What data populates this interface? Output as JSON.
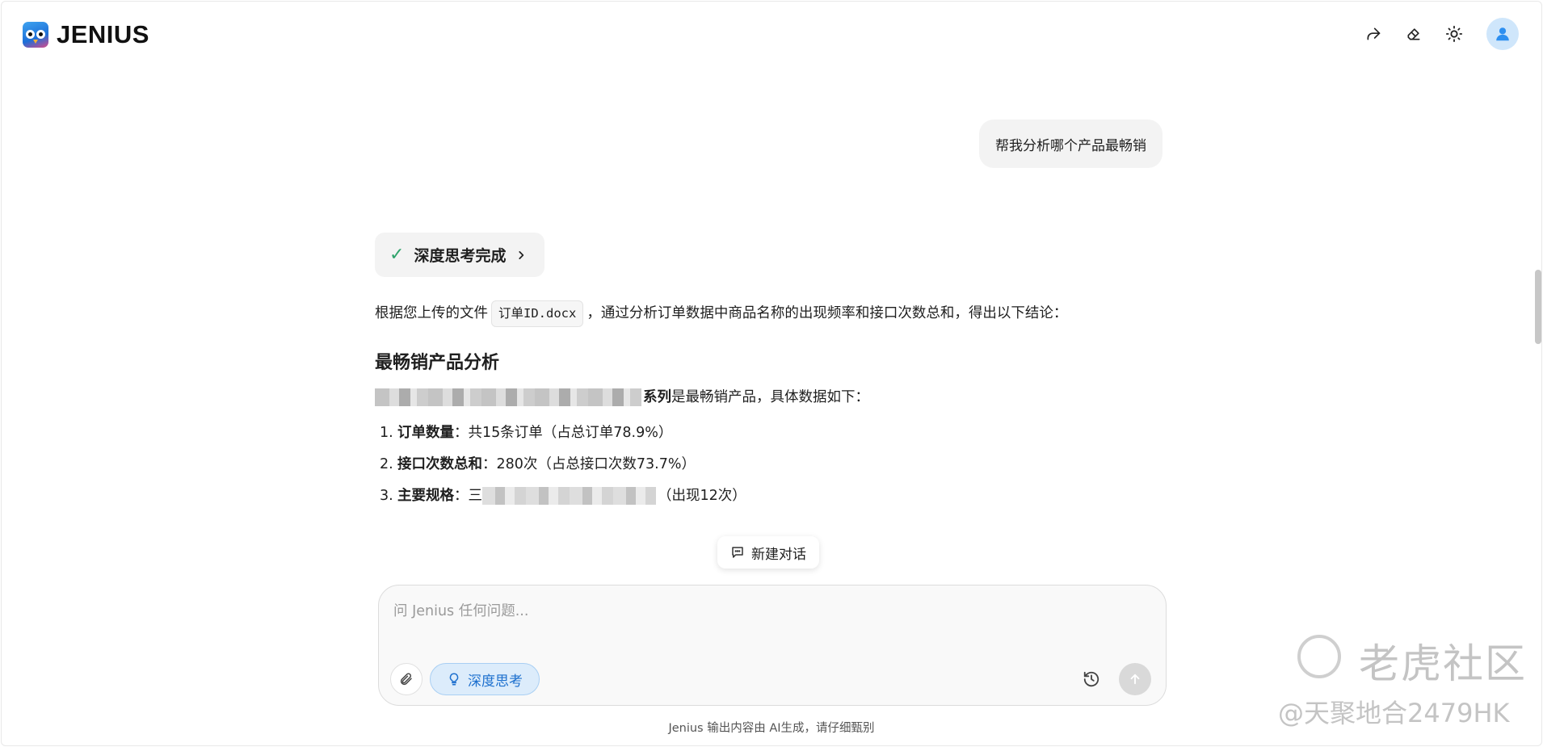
{
  "app": {
    "logo_text": "JENIUS"
  },
  "header": {
    "icons": [
      "share-icon",
      "eraser-icon",
      "sun-icon",
      "user-avatar-icon"
    ]
  },
  "chat": {
    "user_message": "帮我分析哪个产品最畅销",
    "thinking_status": "深度思考完成",
    "answer": {
      "intro_before": "根据您上传的文件",
      "file_name": "订单ID.docx",
      "intro_after": "，通过分析订单数据中商品名称的出现频率和接口次数总和，得出以下结论：",
      "heading": "最畅销产品分析",
      "product_suffix": "系列",
      "product_statement": " 是最畅销产品，具体数据如下：",
      "items": [
        {
          "num": "1.",
          "label": "订单数量",
          "value": "：共15条订单（占总订单78.9%）"
        },
        {
          "num": "2.",
          "label": "接口次数总和",
          "value": "：280次（占总接口次数73.7%）"
        },
        {
          "num": "3.",
          "label": "主要规格",
          "value_prefix": "：三",
          "value": "（出现12次）"
        }
      ]
    }
  },
  "new_chat_label": "新建对话",
  "composer": {
    "placeholder": "问 Jenius 任何问题...",
    "deep_think_label": "深度思考"
  },
  "disclaimer": "Jenius 输出内容由 AI生成，请仔细甄别",
  "watermark": {
    "title": "老虎社区",
    "handle": "@天聚地合2479HK"
  },
  "colors": {
    "accent": "#1c6fce",
    "success": "#2fa36b",
    "bubble": "#f3f3f3"
  }
}
